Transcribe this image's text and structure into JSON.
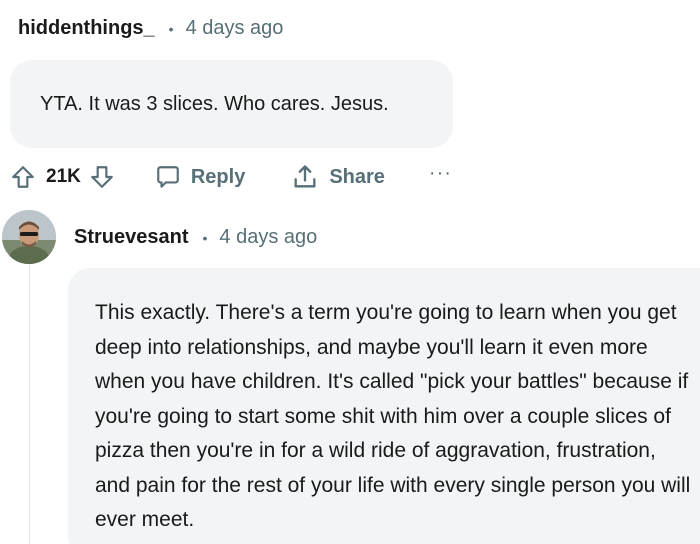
{
  "comment1": {
    "username": "hiddenthings_",
    "separator": "•",
    "time": "4 days ago",
    "body": "YTA. It was 3 slices. Who cares. Jesus.",
    "actions": {
      "vote_count": "21K",
      "reply_label": "Reply",
      "share_label": "Share",
      "more_label": "···"
    }
  },
  "comment2": {
    "username": "Struevesant",
    "separator": "•",
    "time": "4 days ago",
    "body": "This exactly. There's a term you're going to learn when you get deep into relationships, and maybe you'll learn it even more when you have children. It's called \"pick your battles\" because if you're going to start some shit with him over a couple slices of pizza then you're in for a wild ride of aggravation, frustration, and pain for the rest of your life with every single person you will ever meet."
  },
  "icons": {
    "upvote": "upvote-icon",
    "downvote": "downvote-icon",
    "reply": "speech-bubble-icon",
    "share": "share-icon"
  },
  "colors": {
    "text": "#1a1a1b",
    "meta": "#576f76",
    "bubble": "#f2f4f5"
  }
}
